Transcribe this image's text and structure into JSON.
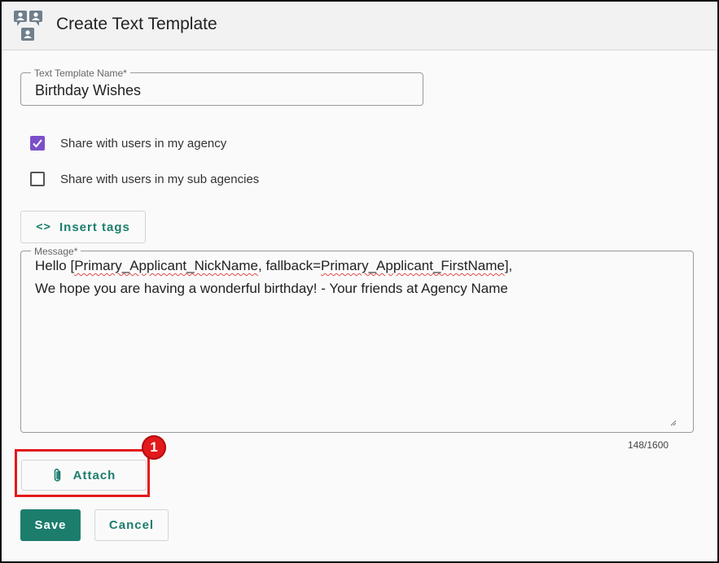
{
  "header": {
    "title": "Create Text Template",
    "icon": "contacts-chat-icon"
  },
  "template_name": {
    "label": "Text Template Name*",
    "value": "Birthday Wishes"
  },
  "sharing": [
    {
      "label": "Share with users in my agency",
      "checked": true
    },
    {
      "label": "Share with users in my sub agencies",
      "checked": false
    }
  ],
  "insert_tags": {
    "label": "Insert tags",
    "icon": "code-brackets-icon"
  },
  "message": {
    "label": "Message*",
    "line1_pre": "Hello [",
    "line1_tag": "Primary_Applicant_NickName",
    "line1_mid": ", fallback=",
    "line1_tag2": "Primary_Applicant_FirstName",
    "line1_post": "],",
    "line2": "We hope you are having a wonderful birthday! - Your friends at Agency Name",
    "counter": "148/1600"
  },
  "attach": {
    "label": "Attach",
    "icon": "paperclip-icon"
  },
  "annotation": {
    "badge": "1"
  },
  "actions": {
    "save_label": "Save",
    "cancel_label": "Cancel"
  },
  "colors": {
    "accent": "#1c7d6d",
    "checkbox": "#7b4fc9",
    "highlight": "#e3191c"
  }
}
